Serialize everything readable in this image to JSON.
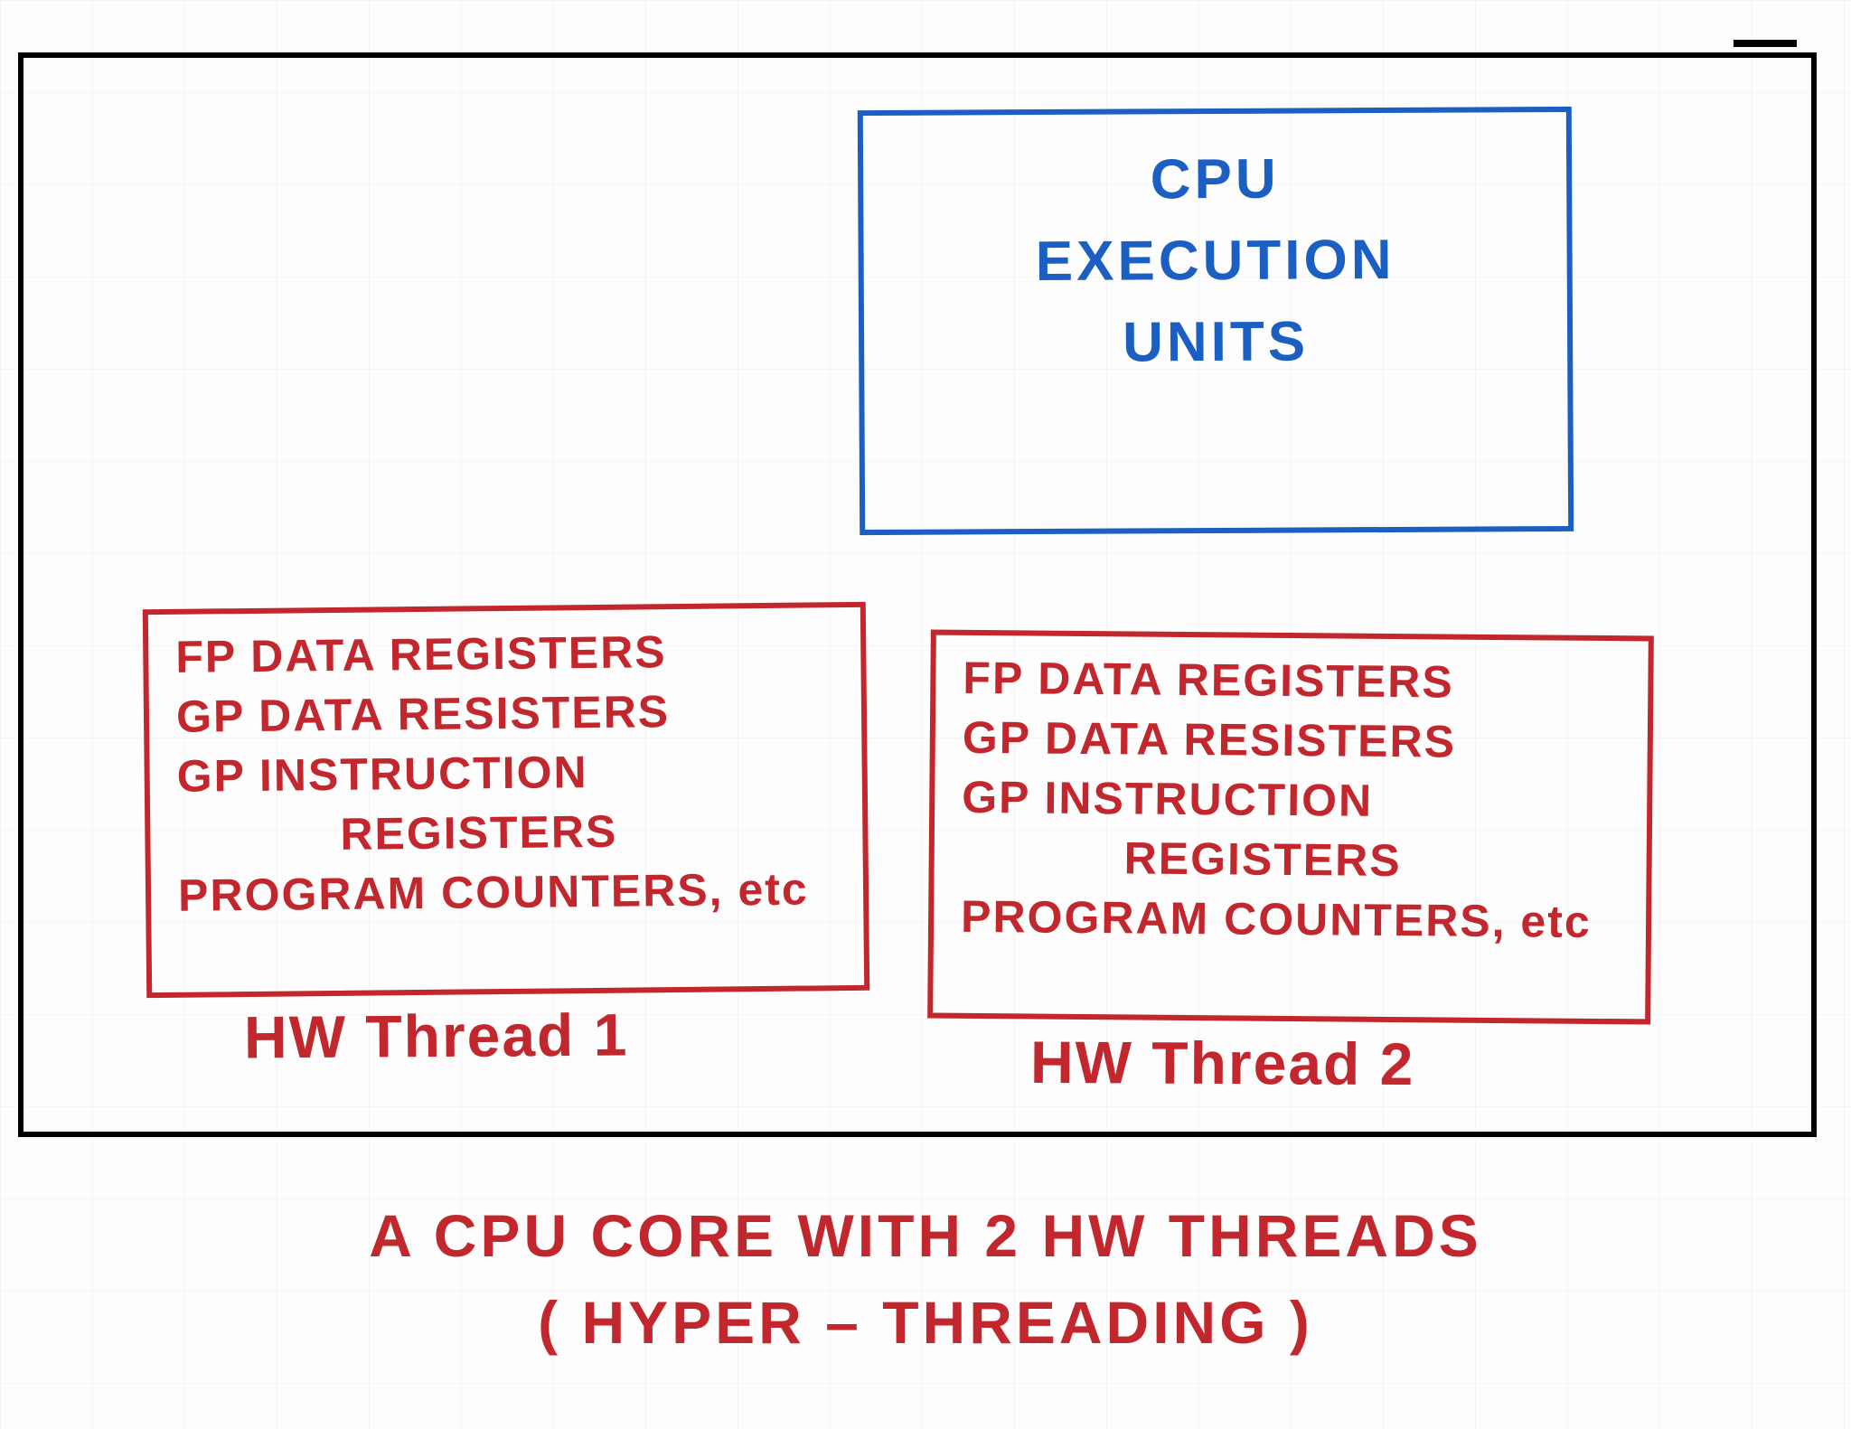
{
  "colors": {
    "black": "#000000",
    "blue": "#1b5fc2",
    "red": "#c1272d"
  },
  "core": {
    "execution_units": {
      "line1": "CPU",
      "line2": "EXECUTION",
      "line3": "UNITS"
    },
    "threads": [
      {
        "label": "HW Thread 1",
        "contents": {
          "line1": "FP DATA REGISTERS",
          "line2": "GP DATA RESISTERS",
          "line3": "GP INSTRUCTION",
          "line3b": "REGISTERS",
          "line4": "PROGRAM COUNTERS, etc"
        }
      },
      {
        "label": "HW Thread 2",
        "contents": {
          "line1": "FP DATA REGISTERS",
          "line2": "GP DATA RESISTERS",
          "line3": "GP INSTRUCTION",
          "line3b": "REGISTERS",
          "line4": "PROGRAM COUNTERS, etc"
        }
      }
    ]
  },
  "caption": {
    "line1": "A CPU CORE  WITH  2 HW THREADS",
    "line2": "( HYPER – THREADING )"
  }
}
